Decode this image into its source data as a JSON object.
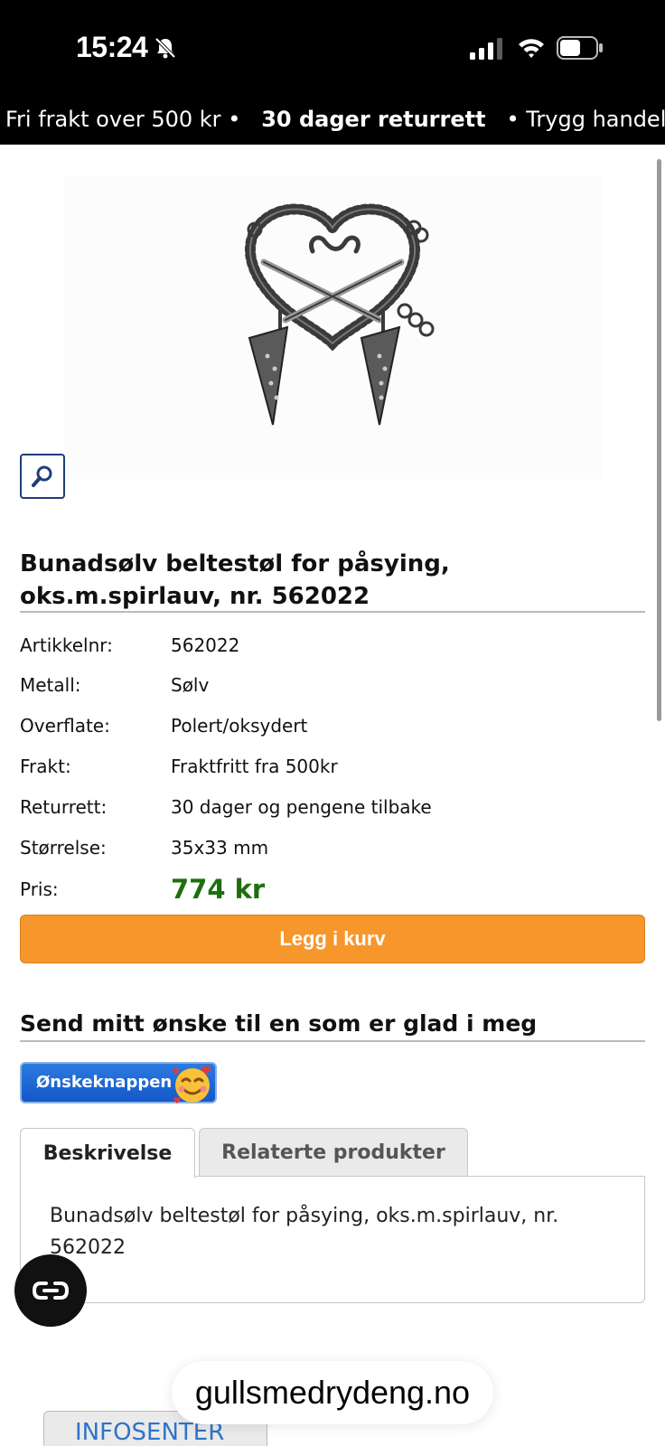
{
  "status_bar": {
    "time": "15:24",
    "icons": [
      "bell-slash-icon",
      "signal-icon",
      "wifi-icon",
      "battery-icon"
    ]
  },
  "promo": {
    "item1": "Fri frakt over 500 kr",
    "item2": "30 dager returrett",
    "item3": "Trygg handel",
    "separator": "•"
  },
  "product": {
    "title": "Bunadsølv beltestøl for påsying, oks.m.spirlauv, nr. 562022",
    "specs": [
      {
        "label": "Artikkelnr:",
        "value": "562022"
      },
      {
        "label": "Metall:",
        "value": "Sølv"
      },
      {
        "label": "Overflate:",
        "value": "Polert/oksydert"
      },
      {
        "label": "Frakt:",
        "value": "Fraktfritt fra 500kr"
      },
      {
        "label": "Returrett:",
        "value": "30 dager og pengene tilbake"
      },
      {
        "label": "Størrelse:",
        "value": "35x33 mm"
      }
    ],
    "price_label": "Pris:",
    "price": "774 kr",
    "add_to_cart": "Legg i kurv"
  },
  "wish": {
    "heading": "Send mitt ønske til en som er glad i meg",
    "button_label": "Ønskeknappen"
  },
  "tabs": {
    "items": [
      {
        "label": "Beskrivelse",
        "active": true
      },
      {
        "label": "Relaterte produkter",
        "active": false
      }
    ],
    "panel_text": "Bunadsølv beltestøl for påsying, oks.m.spirlauv, nr. 562022"
  },
  "info_center": "INFOSENTER",
  "browser": {
    "url": "gullsmedrydeng.no"
  },
  "colors": {
    "accent": "#f7962b",
    "price": "#1e6e0e",
    "banner_bg": "#000000",
    "link": "#2e73c8"
  }
}
